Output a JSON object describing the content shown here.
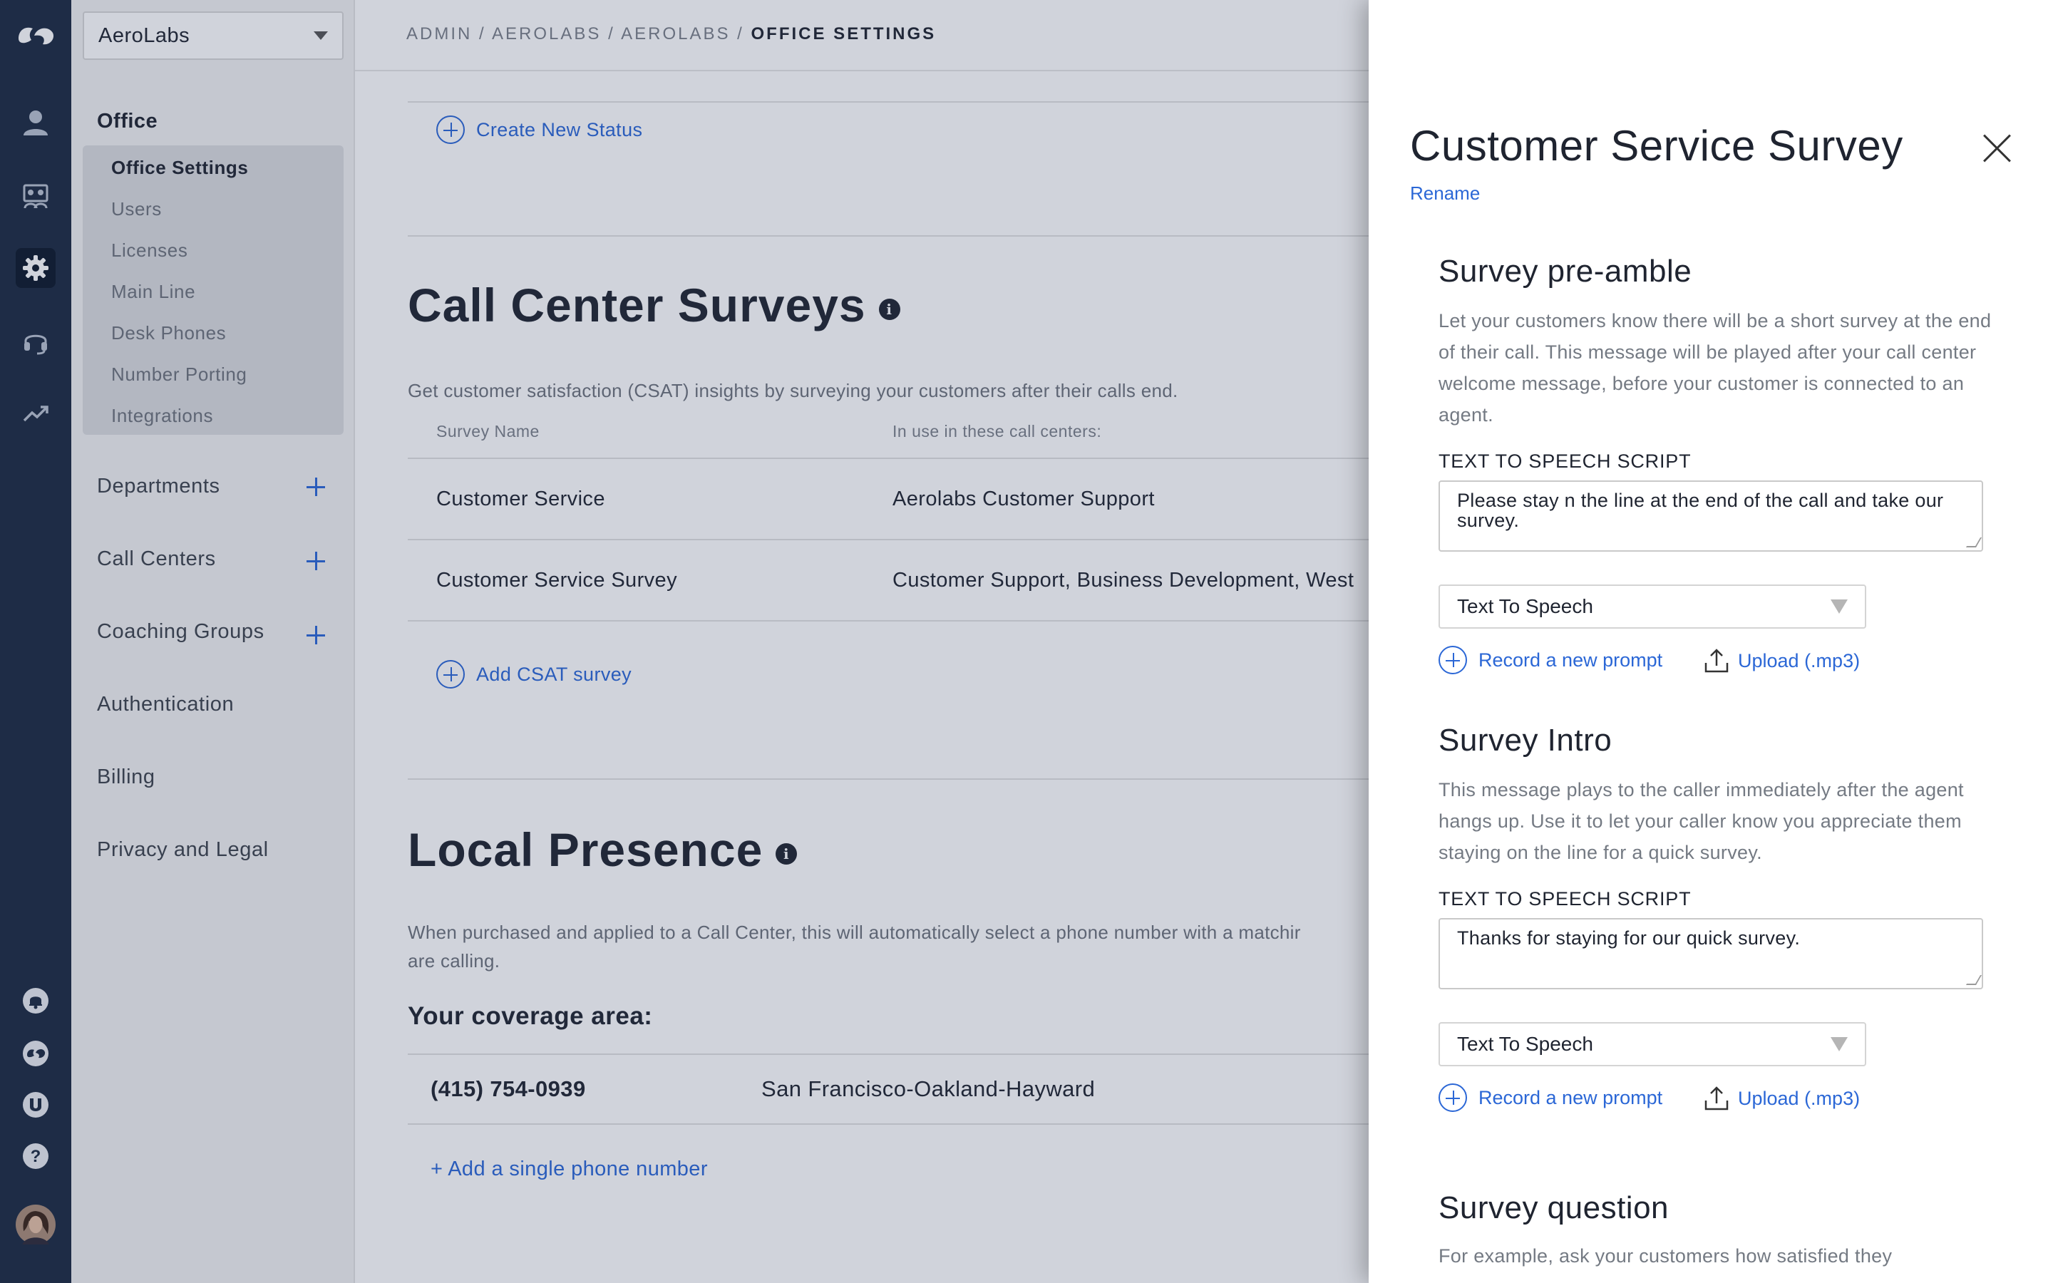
{
  "app": {
    "logo": "dialpad-logo"
  },
  "rail": {
    "icons": [
      "logo-icon",
      "user-icon",
      "contact-center-icon",
      "gear-icon",
      "headset-icon",
      "analytics-icon",
      "notification-icon",
      "dialpad-icon",
      "u-icon",
      "help-icon",
      "avatar"
    ]
  },
  "sidebar": {
    "office_select": "AeroLabs",
    "section_title": "Office",
    "subitems": [
      "Office Settings",
      "Users",
      "Licenses",
      "Main Line",
      "Desk Phones",
      "Number Porting",
      "Integrations"
    ],
    "sections": [
      "Departments",
      "Call Centers",
      "Coaching Groups",
      "Authentication",
      "Billing",
      "Privacy and Legal"
    ]
  },
  "header": {
    "crumb_1": "ADMIN",
    "crumb_2": "AEROLABS",
    "crumb_3": "AEROLABS",
    "crumb_current": "OFFICE SETTINGS",
    "sep": "/"
  },
  "main": {
    "create_status": "Create New Status",
    "surveys": {
      "title": "Call Center Surveys",
      "info": "i",
      "description": "Get customer satisfaction (CSAT) insights by surveying your customers after their calls end.",
      "col_name": "Survey Name",
      "col_centers": "In use in these call centers:",
      "rows": [
        {
          "name": "Customer Service",
          "centers": "Aerolabs Customer Support"
        },
        {
          "name": "Customer Service Survey",
          "centers": "Customer Support, Business Development, West"
        }
      ],
      "add": "Add CSAT survey"
    },
    "local_presence": {
      "title": "Local Presence",
      "info": "i",
      "description_1": "When purchased and applied to a Call Center, this will automatically select a phone number with a matchir",
      "description_2": "are calling.",
      "coverage_label": "Your coverage area:",
      "number": "(415) 754-0939",
      "area": "San Francisco-Oakland-Hayward",
      "add": "+ Add a single phone number"
    }
  },
  "panel": {
    "title": "Customer Service Survey",
    "rename": "Rename",
    "preamble": {
      "title": "Survey pre-amble",
      "desc": "Let your customers know there will be a short survey at the end of their call. This message will be played after your call center welcome message, before your customer is connected to an agent.",
      "tts_label": "TEXT TO SPEECH SCRIPT",
      "script": "Please stay n the line at the end of the call and take our survey.",
      "mode": "Text To Speech",
      "record": "Record a new prompt",
      "upload": "Upload (.mp3)"
    },
    "intro": {
      "title": "Survey Intro",
      "desc": "This message plays to the caller immediately after the agent hangs up. Use it to let your caller know you appreciate them staying on the line for a quick survey.",
      "tts_label": "TEXT TO SPEECH SCRIPT",
      "script": "Thanks for staying for our quick survey.",
      "mode": "Text To Speech",
      "record": "Record a new prompt",
      "upload": "Upload (.mp3)"
    },
    "question": {
      "title": "Survey question",
      "desc": "For example, ask your customers how satisfied they"
    }
  },
  "colors": {
    "accent": "#2b67d6",
    "rail": "#1b2a40",
    "text": "#1f2430"
  }
}
